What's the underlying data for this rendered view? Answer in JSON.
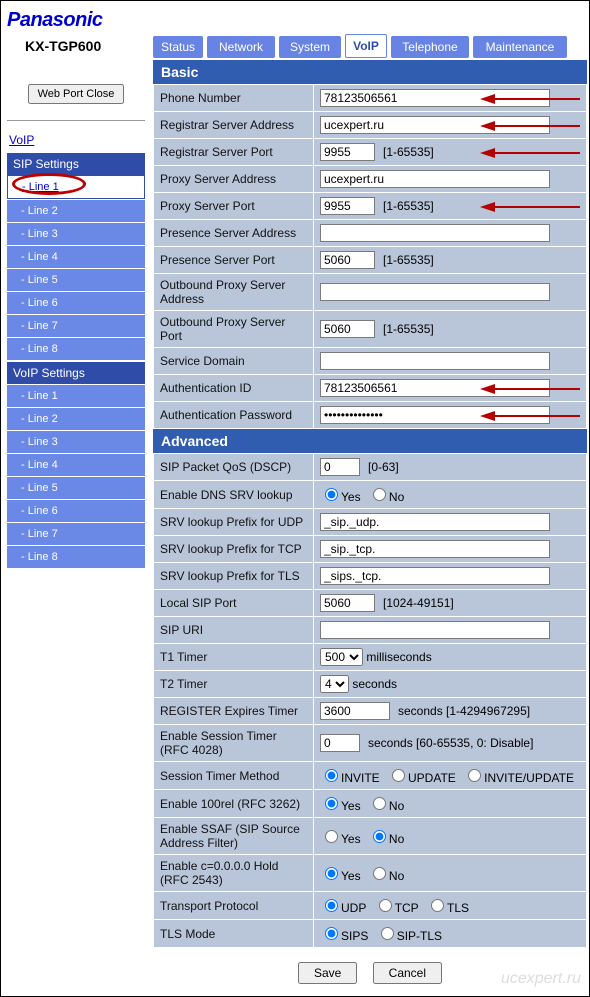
{
  "brand": "Panasonic",
  "model": "KX-TGP600",
  "tabs": {
    "status": "Status",
    "network": "Network",
    "system": "System",
    "voip": "VoIP",
    "telephone": "Telephone",
    "maintenance": "Maintenance"
  },
  "sidebar": {
    "btn": "Web Port Close",
    "title": "VoIP",
    "sip_head": "SIP Settings",
    "voip_head": "VoIP Settings",
    "lines": [
      "- Line 1",
      "- Line 2",
      "- Line 3",
      "- Line 4",
      "- Line 5",
      "- Line 6",
      "- Line 7",
      "- Line 8"
    ]
  },
  "basic": {
    "head": "Basic",
    "phone_lbl": "Phone Number",
    "phone": "78123506561",
    "reg_addr_lbl": "Registrar Server Address",
    "reg_addr": "ucexpert.ru",
    "reg_port_lbl": "Registrar Server Port",
    "reg_port": "9955",
    "reg_port_hint": "[1-65535]",
    "proxy_addr_lbl": "Proxy Server Address",
    "proxy_addr": "ucexpert.ru",
    "proxy_port_lbl": "Proxy Server Port",
    "proxy_port": "9955",
    "proxy_port_hint": "[1-65535]",
    "pres_addr_lbl": "Presence Server Address",
    "pres_addr": "",
    "pres_port_lbl": "Presence Server Port",
    "pres_port": "5060",
    "pres_port_hint": "[1-65535]",
    "out_addr_lbl": "Outbound Proxy Server Address",
    "out_addr": "",
    "out_port_lbl": "Outbound Proxy Server Port",
    "out_port": "5060",
    "out_port_hint": "[1-65535]",
    "svc_lbl": "Service Domain",
    "svc": "",
    "auth_id_lbl": "Authentication ID",
    "auth_id": "78123506561",
    "auth_pw_lbl": "Authentication Password",
    "auth_pw": "••••••••••••••"
  },
  "adv": {
    "head": "Advanced",
    "qos_lbl": "SIP Packet QoS (DSCP)",
    "qos": "0",
    "qos_hint": "[0-63]",
    "dns_lbl": "Enable DNS SRV lookup",
    "srv_udp_lbl": "SRV lookup Prefix for UDP",
    "srv_udp": "_sip._udp.",
    "srv_tcp_lbl": "SRV lookup Prefix for TCP",
    "srv_tcp": "_sip._tcp.",
    "srv_tls_lbl": "SRV lookup Prefix for TLS",
    "srv_tls": "_sips._tcp.",
    "lport_lbl": "Local SIP Port",
    "lport": "5060",
    "lport_hint": "[1024-49151]",
    "uri_lbl": "SIP URI",
    "uri": "",
    "t1_lbl": "T1 Timer",
    "t1": "500",
    "t1_unit": "milliseconds",
    "t2_lbl": "T2 Timer",
    "t2": "4",
    "t2_unit": "seconds",
    "reg_exp_lbl": "REGISTER Expires Timer",
    "reg_exp": "3600",
    "reg_exp_hint": "seconds [1-4294967295]",
    "sess_lbl": "Enable Session Timer (RFC 4028)",
    "sess": "0",
    "sess_hint": "seconds [60-65535, 0: Disable]",
    "method_lbl": "Session Timer Method",
    "rel_lbl": "Enable 100rel (RFC 3262)",
    "ssaf_lbl": "Enable SSAF (SIP Source Address Filter)",
    "hold_lbl": "Enable c=0.0.0.0 Hold (RFC 2543)",
    "trans_lbl": "Transport Protocol",
    "tls_lbl": "TLS Mode"
  },
  "opt": {
    "yes": "Yes",
    "no": "No",
    "invite": "INVITE",
    "update": "UPDATE",
    "invup": "INVITE/UPDATE",
    "udp": "UDP",
    "tcp": "TCP",
    "tls": "TLS",
    "sips": "SIPS",
    "siptls": "SIP-TLS"
  },
  "footer": {
    "save": "Save",
    "cancel": "Cancel",
    "watermark": "ucexpert.ru"
  }
}
